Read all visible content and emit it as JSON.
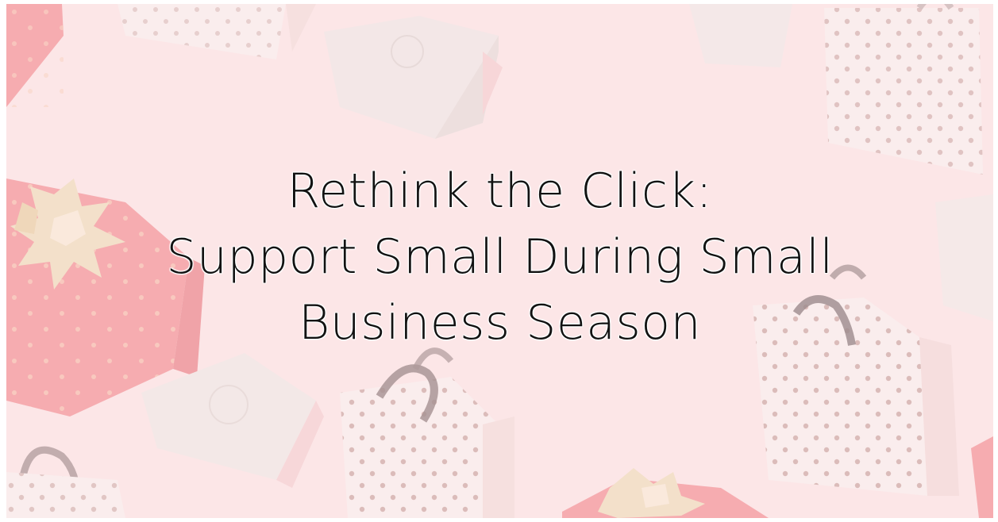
{
  "title_lines": [
    "Rethink the Click:",
    "Support Small During Small",
    "Business Season"
  ],
  "colors": {
    "background": "#fbe3e4",
    "text": "#121212",
    "bag_white": "#f7f1ee",
    "box_red": "#f07a80",
    "box_grey": "#ebe7e4",
    "dots": "#c09892",
    "bow_gold": "#ead5a8"
  },
  "icons": [
    "polka-dot-gift-bag-icon",
    "red-gift-box-icon",
    "gold-bow-icon",
    "grey-gift-box-icon"
  ]
}
